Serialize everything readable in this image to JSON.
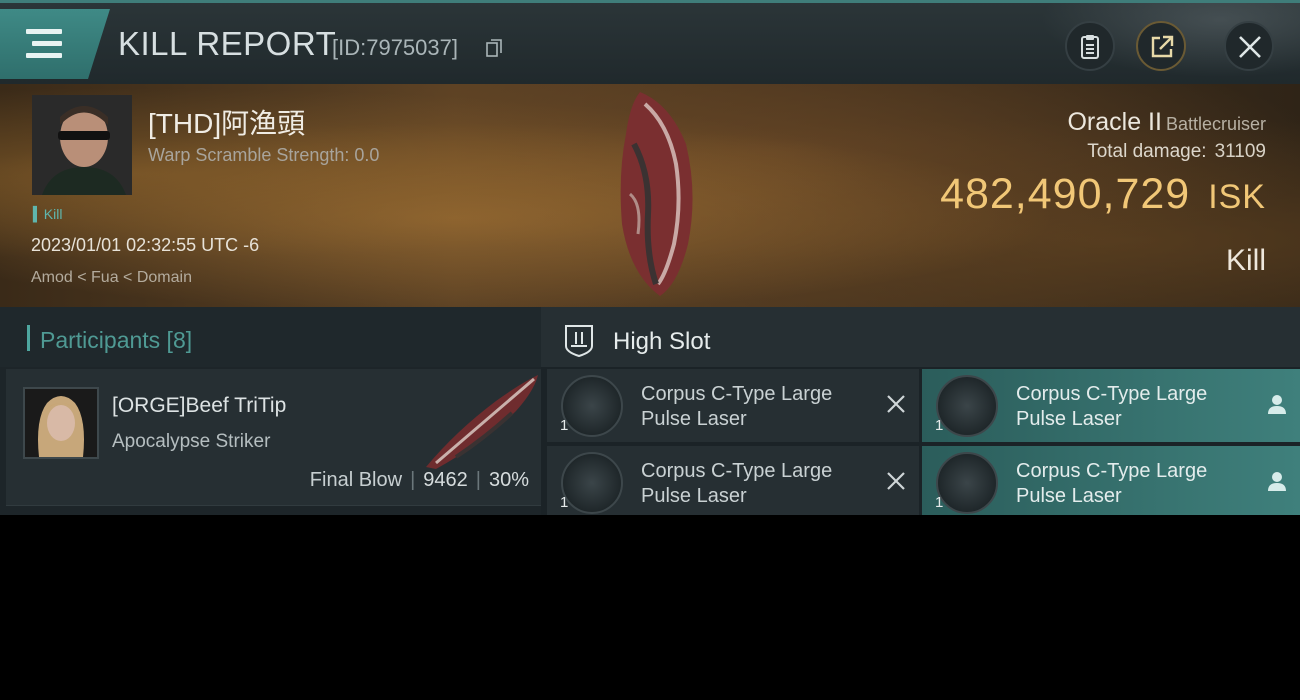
{
  "header": {
    "title": "KILL REPORT",
    "report_id": "[ID:7975037]"
  },
  "victim": {
    "pilot_name": "[THD]阿渔頭",
    "warp_scramble": "Warp Scramble Strength: 0.0",
    "kill_tag": "Kill",
    "datetime": "2023/01/01 02:32:55 UTC -6",
    "location": "Amod < Fua < Domain",
    "ship_name": "Oracle II",
    "ship_class": "Battlecruiser",
    "total_damage_label": "Total damage:",
    "total_damage": "31109",
    "isk_value": "482,490,729",
    "isk_unit": "ISK",
    "kill_type": "Kill"
  },
  "participants": {
    "title": "Participants [8]",
    "items": [
      {
        "name": "[ORGE]Beef TriTip",
        "ship": "Apocalypse Striker",
        "blow": "Final Blow",
        "damage": "9462",
        "percent": "30%"
      }
    ]
  },
  "high_slot": {
    "title": "High Slot",
    "modules": [
      {
        "name": "Corpus C-Type Large Pulse Laser",
        "qty": "1",
        "status": "destroyed",
        "icon": "close-icon"
      },
      {
        "name": "Corpus C-Type Large Pulse Laser",
        "qty": "1",
        "status": "dropped",
        "icon": "person-icon"
      },
      {
        "name": "Corpus C-Type Large Pulse Laser",
        "qty": "1",
        "status": "destroyed",
        "icon": "close-icon"
      },
      {
        "name": "Corpus C-Type Large Pulse Laser",
        "qty": "1",
        "status": "dropped",
        "icon": "person-icon"
      }
    ]
  },
  "colors": {
    "accent": "#3f8a86",
    "isk": "#f1c777",
    "dropped_bg": "#3f807c"
  }
}
